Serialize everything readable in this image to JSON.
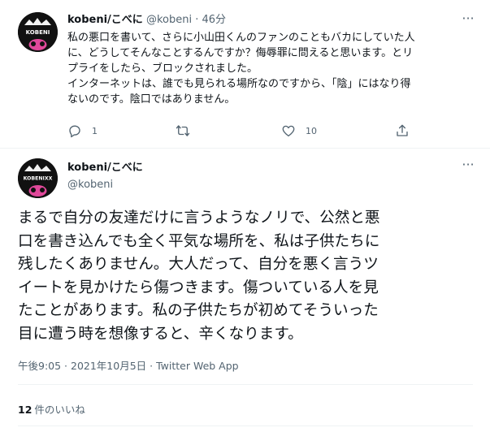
{
  "tweet1": {
    "display_name": "kobeni/こべに",
    "handle": "@kobeni",
    "separator": "·",
    "time": "46分",
    "text": "私の悪口を書いて、さらに小山田くんのファンのこともバカにしていた人\nに、どうしてそんなことするんですか？侮辱罪に問えると思います。とリ\nプライをしたら、ブロックされました。\nインターネットは、誰でも見られる場所なのですから、「陰」にはなり得\nないのです。陰口ではありません。",
    "reply_count": "1",
    "like_count": "10",
    "avatar_text": "KOBENI"
  },
  "tweet2": {
    "display_name": "kobeni/こべに",
    "handle": "@kobeni",
    "avatar_text": "KOBENIXX",
    "text": "まるで自分の友達だけに言うようなノリで、公然と悪\n口を書き込んでも全く平気な場所を、私は子供たちに\n残したくありません。大人だって、自分を悪く言うツ\nイートを見かけたら傷つきます。傷ついている人を見\nたことがあります。私の子供たちが初めてそういった\n目に遭う時を想像すると、辛くなります。",
    "meta": "午後9:05 · 2021年10月5日 · Twitter Web App",
    "likes_count": "12",
    "likes_label": "件のいいね"
  },
  "icons": {
    "reply": "reply-icon",
    "retweet": "retweet-icon",
    "like": "heart-icon",
    "share": "share-icon",
    "more": "more-icon"
  },
  "colors": {
    "text": "#0f1419",
    "secondary": "#536471",
    "divider": "#eff3f4",
    "avatar_accent": "#e0489a"
  }
}
